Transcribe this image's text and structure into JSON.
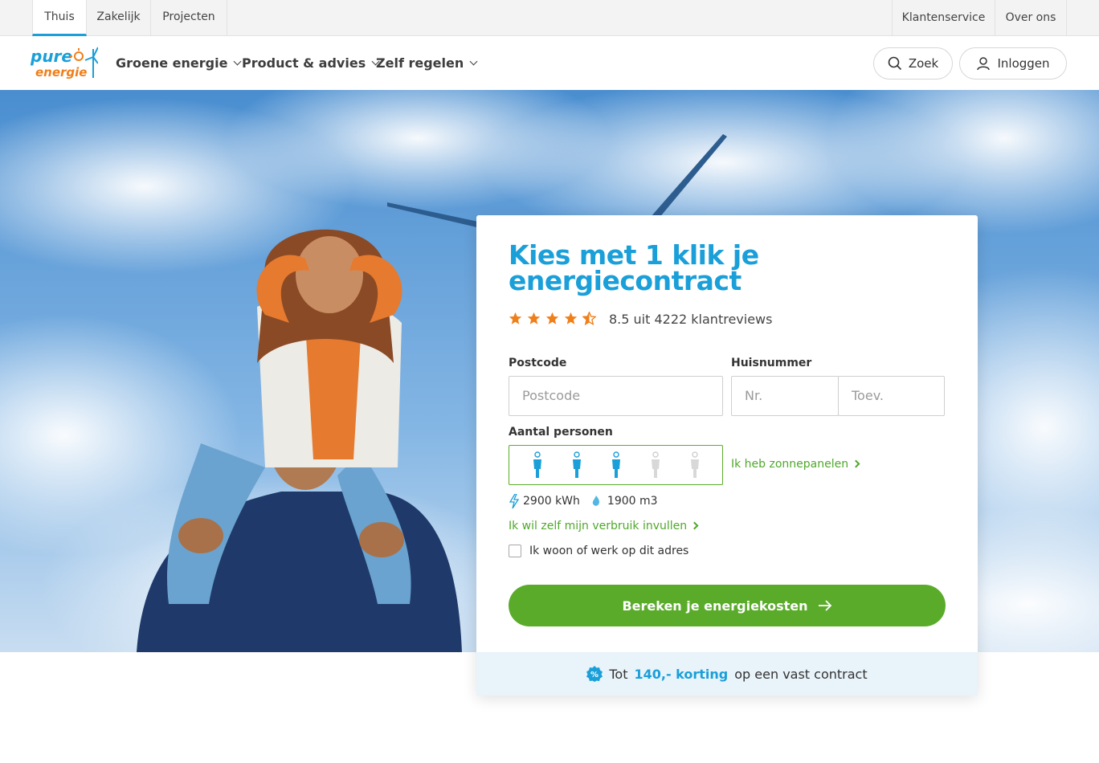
{
  "topbar": {
    "left_tabs": [
      "Thuis",
      "Zakelijk",
      "Projecten"
    ],
    "right_tabs": [
      "Klantenservice",
      "Over ons"
    ]
  },
  "brand": {
    "logo_line1": "pure",
    "logo_line2": "energie",
    "primary": "#1a9fd9",
    "accent_green": "#5bab2b",
    "accent_orange": "#f07f1a"
  },
  "nav": {
    "items": [
      "Groene energie",
      "Product & advies",
      "Zelf regelen"
    ],
    "search_label": "Zoek",
    "login_label": "Inloggen"
  },
  "card": {
    "title_line1": "Kies met 1 klik je",
    "title_line2": "energiecontract",
    "rating": {
      "stars": 4.5,
      "text": "8.5 uit 4222 klantreviews"
    },
    "postcode_label": "Postcode",
    "postcode_placeholder": "Postcode",
    "huisnummer_label": "Huisnummer",
    "nr_placeholder": "Nr.",
    "toev_placeholder": "Toev.",
    "persons_label": "Aantal personen",
    "persons_selected": 3,
    "persons_max": 5,
    "solar_link": "Ik heb zonnepanelen",
    "usage_electricity": "2900 kWh",
    "usage_gas": "1900 m3",
    "own_usage_link": "Ik wil zelf mijn verbruik invullen",
    "checkbox_label": "Ik woon of werk op dit adres",
    "cta_label": "Bereken je energiekosten",
    "promo_prefix": "Tot",
    "promo_highlight": "140,- korting",
    "promo_suffix": "op een vast contract"
  }
}
